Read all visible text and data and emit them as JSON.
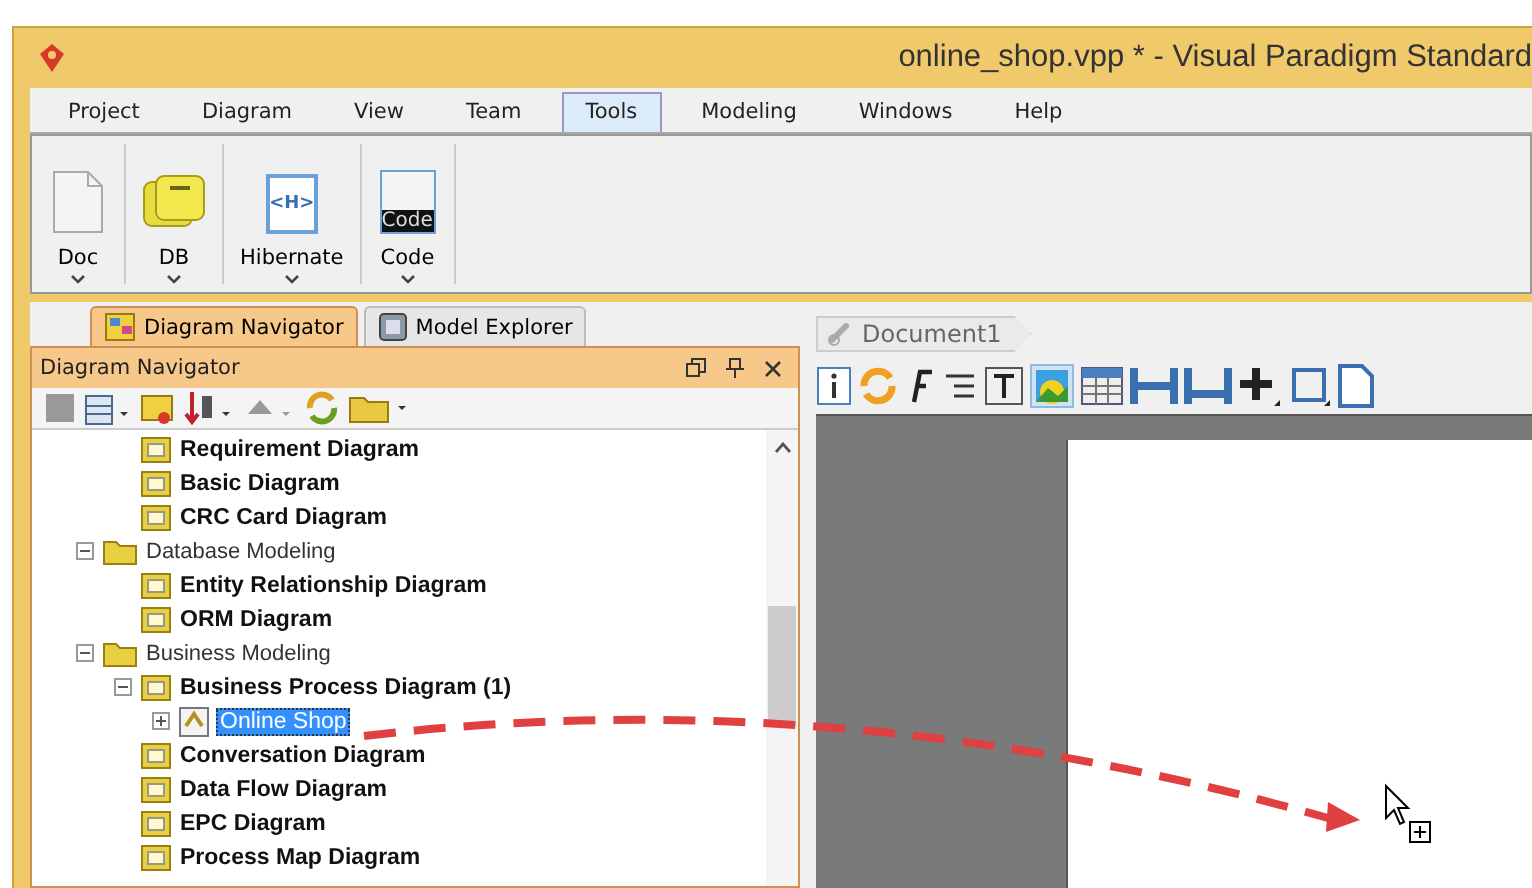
{
  "window": {
    "title": "online_shop.vpp * - Visual Paradigm Standard"
  },
  "menu": [
    {
      "label": "Project",
      "selected": false
    },
    {
      "label": "Diagram",
      "selected": false
    },
    {
      "label": "View",
      "selected": false
    },
    {
      "label": "Team",
      "selected": false
    },
    {
      "label": "Tools",
      "selected": true
    },
    {
      "label": "Modeling",
      "selected": false
    },
    {
      "label": "Windows",
      "selected": false
    },
    {
      "label": "Help",
      "selected": false
    }
  ],
  "ribbon": [
    {
      "label": "Doc",
      "kind": "doc"
    },
    {
      "label": "DB",
      "kind": "db"
    },
    {
      "label": "Hibernate",
      "kind": "hibernate",
      "icon_text": "<H>"
    },
    {
      "label": "Code",
      "kind": "code",
      "icon_text": "Code"
    }
  ],
  "panel_tabs": [
    {
      "label": "Diagram Navigator",
      "selected": true
    },
    {
      "label": "Model Explorer",
      "selected": false
    }
  ],
  "panel": {
    "title": "Diagram Navigator"
  },
  "tree": [
    {
      "children": [
        {
          "label": "Requirement Diagram",
          "kind": "type"
        },
        {
          "label": "Basic Diagram",
          "kind": "type"
        },
        {
          "label": "CRC Card Diagram",
          "kind": "type"
        }
      ]
    },
    {
      "label": "Database Modeling",
      "kind": "folder",
      "expanded": true,
      "children": [
        {
          "label": "Entity Relationship Diagram",
          "kind": "type"
        },
        {
          "label": "ORM Diagram",
          "kind": "type"
        }
      ]
    },
    {
      "label": "Business Modeling",
      "kind": "folder",
      "expanded": true,
      "children": [
        {
          "label": "Business Process Diagram (1)",
          "kind": "type",
          "expanded": true,
          "children": [
            {
              "label": "Online Shop",
              "kind": "diagram",
              "expanded": false,
              "selected": true
            }
          ]
        },
        {
          "label": "Conversation Diagram",
          "kind": "type"
        },
        {
          "label": "Data Flow Diagram",
          "kind": "type"
        },
        {
          "label": "EPC Diagram",
          "kind": "type"
        },
        {
          "label": "Process Map Diagram",
          "kind": "type"
        }
      ]
    }
  ],
  "editor": {
    "breadcrumb": "Document1"
  }
}
